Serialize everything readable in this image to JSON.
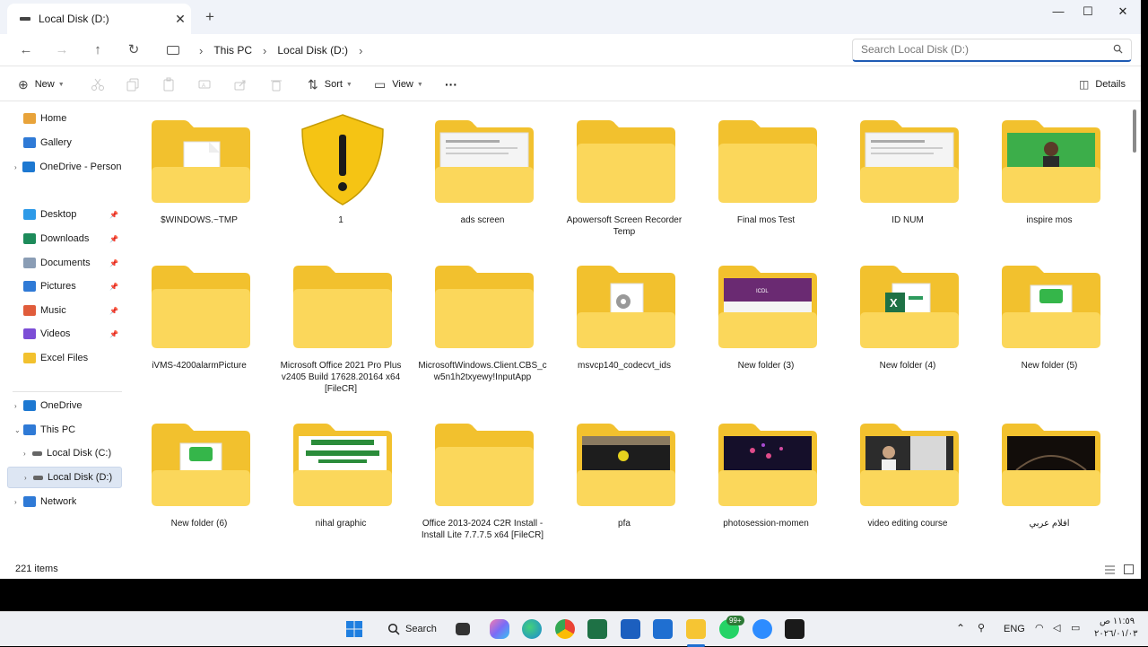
{
  "window": {
    "tab_title": "Local Disk (D:)",
    "tab_close": "✕",
    "new_tab": "+",
    "minimize": "—",
    "maximize": "☐",
    "close": "✕"
  },
  "nav": {
    "breadcrumb": [
      "This PC",
      "Local Disk (D:)"
    ],
    "search_placeholder": "Search Local Disk (D:)"
  },
  "toolbar": {
    "new_label": "New",
    "sort_label": "Sort",
    "view_label": "View",
    "more_label": "···",
    "details_label": "Details"
  },
  "sidebar": {
    "items": [
      {
        "label": "Home",
        "icon": "home-icon"
      },
      {
        "label": "Gallery",
        "icon": "gallery-icon"
      },
      {
        "label": "OneDrive - Persona",
        "icon": "onedrive-icon"
      },
      {
        "label": "Desktop",
        "icon": "desktop-icon"
      },
      {
        "label": "Downloads",
        "icon": "downloads-icon"
      },
      {
        "label": "Documents",
        "icon": "documents-icon"
      },
      {
        "label": "Pictures",
        "icon": "pictures-icon"
      },
      {
        "label": "Music",
        "icon": "music-icon"
      },
      {
        "label": "Videos",
        "icon": "videos-icon"
      },
      {
        "label": "Excel Files",
        "icon": "folder-icon"
      },
      {
        "label": "OneDrive",
        "icon": "onedrive-icon"
      },
      {
        "label": "This PC",
        "icon": "pc-icon"
      },
      {
        "label": "Local Disk (C:)",
        "icon": "drive-icon"
      },
      {
        "label": "Local Disk (D:)",
        "icon": "drive-icon"
      },
      {
        "label": "Network",
        "icon": "network-icon"
      }
    ]
  },
  "files": [
    {
      "name": "$WINDOWS.~TMP",
      "preview": "document"
    },
    {
      "name": "1",
      "preview": "warning-shield"
    },
    {
      "name": "ads screen",
      "preview": "screenshot"
    },
    {
      "name": "Apowersoft Screen Recorder Temp",
      "preview": "empty"
    },
    {
      "name": "Final mos Test",
      "preview": "empty"
    },
    {
      "name": "ID NUM",
      "preview": "screenshot"
    },
    {
      "name": "inspire mos",
      "preview": "green-photo"
    },
    {
      "name": "iVMS-4200alarmPicture",
      "preview": "empty"
    },
    {
      "name": "Microsoft Office 2021 Pro Plus v2405 Build 17628.20164 x64 [FileCR]",
      "preview": "empty"
    },
    {
      "name": "MicrosoftWindows.Client.CBS_cw5n1h2txyewy!InputApp",
      "preview": "empty"
    },
    {
      "name": "msvcp140_codecvt_ids",
      "preview": "settings-file"
    },
    {
      "name": "New folder (3)",
      "preview": "purple-banner"
    },
    {
      "name": "New folder (4)",
      "preview": "excel"
    },
    {
      "name": "New folder (5)",
      "preview": "green-doc"
    },
    {
      "name": "New folder (6)",
      "preview": "green-doc"
    },
    {
      "name": "nihal graphic",
      "preview": "green-text"
    },
    {
      "name": "Office 2013-2024 C2R Install - Install Lite 7.7.7.5 x64 [FileCR]",
      "preview": "empty"
    },
    {
      "name": "pfa",
      "preview": "dark-photo"
    },
    {
      "name": "photosession-momen",
      "preview": "pink-dark"
    },
    {
      "name": "video editing course",
      "preview": "people-photo"
    },
    {
      "name": "افلام عربي",
      "preview": "car-dark"
    }
  ],
  "status": {
    "item_count": "221 items"
  },
  "taskbar": {
    "search_label": "Search",
    "whatsapp_badge": "99+",
    "language": "ENG",
    "time": "١١:٥٩ ص",
    "date": "٢٠٢٦/٠١/٠٣"
  },
  "colors": {
    "accent": "#1f5bb4",
    "folder_back": "#f2c12e",
    "folder_front": "#fbd75b",
    "selection": "#dde6f3"
  }
}
